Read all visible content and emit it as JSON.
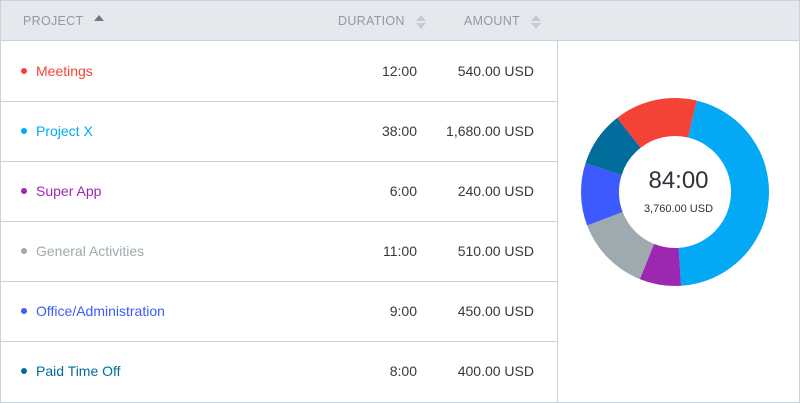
{
  "header": {
    "project_label": "PROJECT",
    "duration_label": "DURATION",
    "amount_label": "AMOUNT"
  },
  "rows": [
    {
      "name": "Meetings",
      "duration": "12:00",
      "amount": "540.00 USD",
      "color": "#f44336"
    },
    {
      "name": "Project X",
      "duration": "38:00",
      "amount": "1,680.00 USD",
      "color": "#03a9f4"
    },
    {
      "name": "Super App",
      "duration": "6:00",
      "amount": "240.00 USD",
      "color": "#9c27b0"
    },
    {
      "name": "General Activities",
      "duration": "11:00",
      "amount": "510.00 USD",
      "color": "#9ea9b0"
    },
    {
      "name": "Office/Administration",
      "duration": "9:00",
      "amount": "450.00 USD",
      "color": "#3d5afe"
    },
    {
      "name": "Paid Time Off",
      "duration": "8:00",
      "amount": "400.00 USD",
      "color": "#006d9c"
    }
  ],
  "summary": {
    "total_time": "84:00",
    "total_amount": "3,760.00 USD"
  },
  "chart_data": {
    "type": "pie",
    "labels": [
      "Meetings",
      "Project X",
      "Super App",
      "General Activities",
      "Office/Administration",
      "Paid Time Off"
    ],
    "values": [
      12,
      38,
      6,
      11,
      9,
      8
    ],
    "colors": [
      "#f44336",
      "#03a9f4",
      "#9c27b0",
      "#9ea9b0",
      "#3d5afe",
      "#006d9c"
    ]
  }
}
